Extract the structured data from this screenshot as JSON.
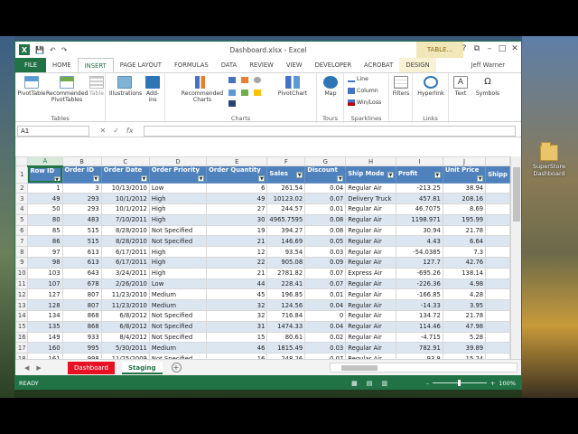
{
  "window": {
    "title": "Dashboard.xlsx - Excel",
    "context_tab": "TABLE...",
    "user": "Jeff Warner"
  },
  "qat": {
    "save": "💾",
    "undo": "↶",
    "redo": "↷"
  },
  "wincontrols": {
    "help": "?",
    "restore": "⧉",
    "minimize": "–",
    "maximize": "□",
    "close": "✕"
  },
  "tabs": [
    "FILE",
    "HOME",
    "INSERT",
    "PAGE LAYOUT",
    "FORMULAS",
    "DATA",
    "REVIEW",
    "VIEW",
    "DEVELOPER",
    "ACROBAT",
    "DESIGN"
  ],
  "ribbon": {
    "tables": {
      "label": "Tables",
      "pivot": "PivotTable",
      "recpivot": "Recommended PivotTables",
      "table": "Table"
    },
    "illustrations": "Illustrations",
    "addins": "Add-ins",
    "charts": {
      "label": "Charts",
      "rec": "Recommended Charts",
      "pivotchart": "PivotChart"
    },
    "tours": {
      "label": "Tours",
      "map": "Map"
    },
    "sparklines": {
      "label": "Sparklines",
      "line": "Line",
      "column": "Column",
      "winloss": "Win/Loss"
    },
    "filters": {
      "label": "Filters"
    },
    "links": {
      "label": "Links",
      "hyperlink": "Hyperlink"
    },
    "text": "Text",
    "symbols": "Symbols"
  },
  "formula_bar": {
    "namebox": "A1",
    "cancel": "✕",
    "enter": "✓",
    "fx": "fx",
    "value": ""
  },
  "columns": [
    "A",
    "B",
    "C",
    "D",
    "E",
    "F",
    "G",
    "H",
    "I",
    "J"
  ],
  "headers": [
    "Row ID",
    "Order ID",
    "Order Date",
    "Order Priority",
    "Order Quantity",
    "Sales",
    "Discount",
    "Ship Mode",
    "Profit",
    "Unit Price",
    "Shipp"
  ],
  "rows": [
    [
      "2",
      "1",
      "3",
      "10/13/2010",
      "Low",
      "6",
      "261.54",
      "0.04",
      "Regular Air",
      "-213.25",
      "38.94"
    ],
    [
      "3",
      "49",
      "293",
      "10/1/2012",
      "High",
      "49",
      "10123.02",
      "0.07",
      "Delivery Truck",
      "457.81",
      "208.16"
    ],
    [
      "4",
      "50",
      "293",
      "10/1/2012",
      "High",
      "27",
      "244.57",
      "0.01",
      "Regular Air",
      "46.7075",
      "8.69"
    ],
    [
      "5",
      "80",
      "483",
      "7/10/2011",
      "High",
      "30",
      "4965.7595",
      "0.08",
      "Regular Air",
      "1198.971",
      "195.99"
    ],
    [
      "6",
      "85",
      "515",
      "8/28/2010",
      "Not Specified",
      "19",
      "394.27",
      "0.08",
      "Regular Air",
      "30.94",
      "21.78"
    ],
    [
      "7",
      "86",
      "515",
      "8/28/2010",
      "Not Specified",
      "21",
      "146.69",
      "0.05",
      "Regular Air",
      "4.43",
      "6.64"
    ],
    [
      "8",
      "97",
      "613",
      "6/17/2011",
      "High",
      "12",
      "93.54",
      "0.03",
      "Regular Air",
      "-54.0385",
      "7.3"
    ],
    [
      "9",
      "98",
      "613",
      "6/17/2011",
      "High",
      "22",
      "905.08",
      "0.09",
      "Regular Air",
      "127.7",
      "42.76"
    ],
    [
      "10",
      "103",
      "643",
      "3/24/2011",
      "High",
      "21",
      "2781.82",
      "0.07",
      "Express Air",
      "-695.26",
      "138.14"
    ],
    [
      "11",
      "107",
      "678",
      "2/26/2010",
      "Low",
      "44",
      "228.41",
      "0.07",
      "Regular Air",
      "-226.36",
      "4.98"
    ],
    [
      "12",
      "127",
      "807",
      "11/23/2010",
      "Medium",
      "45",
      "196.85",
      "0.01",
      "Regular Air",
      "-166.85",
      "4.28"
    ],
    [
      "13",
      "128",
      "807",
      "11/23/2010",
      "Medium",
      "32",
      "124.56",
      "0.04",
      "Regular Air",
      "-14.33",
      "3.95"
    ],
    [
      "14",
      "134",
      "868",
      "6/8/2012",
      "Not Specified",
      "32",
      "716.84",
      "0",
      "Regular Air",
      "134.72",
      "21.78"
    ],
    [
      "15",
      "135",
      "868",
      "6/8/2012",
      "Not Specified",
      "31",
      "1474.33",
      "0.04",
      "Regular Air",
      "114.46",
      "47.98"
    ],
    [
      "16",
      "149",
      "933",
      "8/4/2012",
      "Not Specified",
      "15",
      "80.61",
      "0.02",
      "Regular Air",
      "-4.715",
      "5.28"
    ],
    [
      "17",
      "160",
      "995",
      "5/30/2011",
      "Medium",
      "46",
      "1815.49",
      "0.03",
      "Regular Air",
      "782.91",
      "39.89"
    ],
    [
      "18",
      "161",
      "998",
      "11/25/2009",
      "Not Specified",
      "16",
      "248.26",
      "0.07",
      "Regular Air",
      "93.8",
      "15.74"
    ],
    [
      "19",
      "175",
      "1154",
      "2/14/2012",
      "Critical",
      "44",
      "4462.23",
      "0.04",
      "Delivery Truck",
      "440.72",
      "100.98"
    ]
  ],
  "sheets": [
    "Dashboard",
    "Staging"
  ],
  "sheetnav": {
    "prev": "◀",
    "next": "▶",
    "add": "+"
  },
  "status": {
    "ready": "READY",
    "zoom": "100%",
    "minus": "–",
    "plus": "+"
  },
  "desktop_icon": "SuperStore Dashboard"
}
